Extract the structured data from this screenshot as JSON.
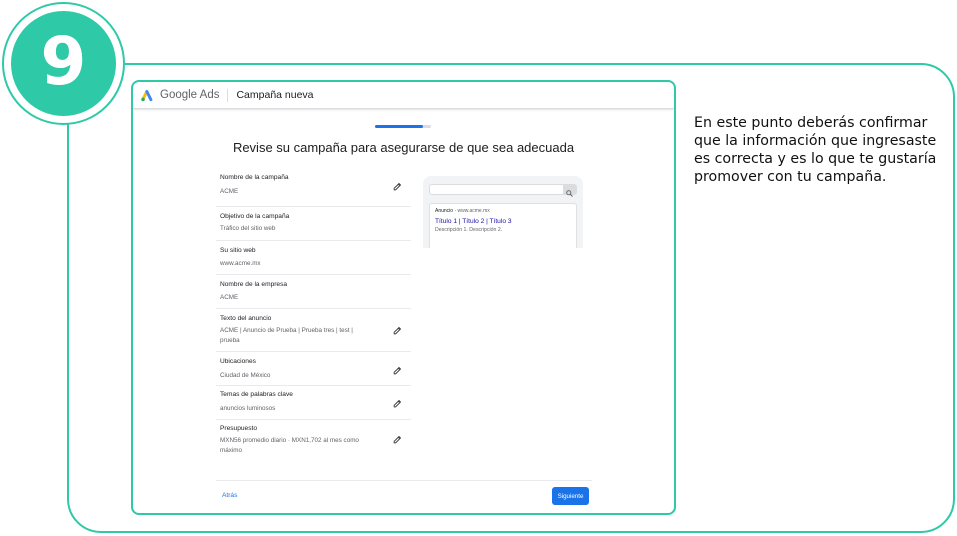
{
  "step": {
    "number": "9"
  },
  "header": {
    "brand": "Google Ads",
    "page_title": "Campaña nueva"
  },
  "progress": {
    "fraction": 0.85
  },
  "page_heading": "Revise su campaña para asegurarse de que sea adecuada",
  "review_items": [
    {
      "label": "Nombre de la campaña",
      "value": "ACME",
      "editable": true
    },
    {
      "label": "Objetivo de la campaña",
      "value": "Tráfico del sitio web",
      "editable": false
    },
    {
      "label": "Su sitio web",
      "value": "www.acme.mx",
      "editable": false
    },
    {
      "label": "Nombre de la empresa",
      "value": "ACME",
      "editable": false
    },
    {
      "label": "Texto del anuncio",
      "value": "ACME | Anuncio de Prueba | Prueba tres | test | prueba",
      "editable": true
    },
    {
      "label": "Ubicaciones",
      "value": "Ciudad de México",
      "editable": true
    },
    {
      "label": "Temas de palabras clave",
      "value": "anuncios luminosos",
      "editable": true
    },
    {
      "label": "Presupuesto",
      "value": "MXN56 promedio diario · MXN1,702 al mes como máximo",
      "editable": true
    }
  ],
  "ad_preview": {
    "label": "Anuncio",
    "url": "www.acme.mx",
    "headline": "Título 1 | Título 2 | Título 3",
    "description": "Descripción 1. Descripción 2."
  },
  "footer": {
    "back_label": "Atrás",
    "next_label": "Siguiente"
  },
  "description_text": "En este punto deberás confirmar que la información que ingresaste es correcta y es lo que te gustaría promover con tu campaña.",
  "colors": {
    "accent": "#2ec9a7",
    "primary_blue": "#1a73e8"
  }
}
